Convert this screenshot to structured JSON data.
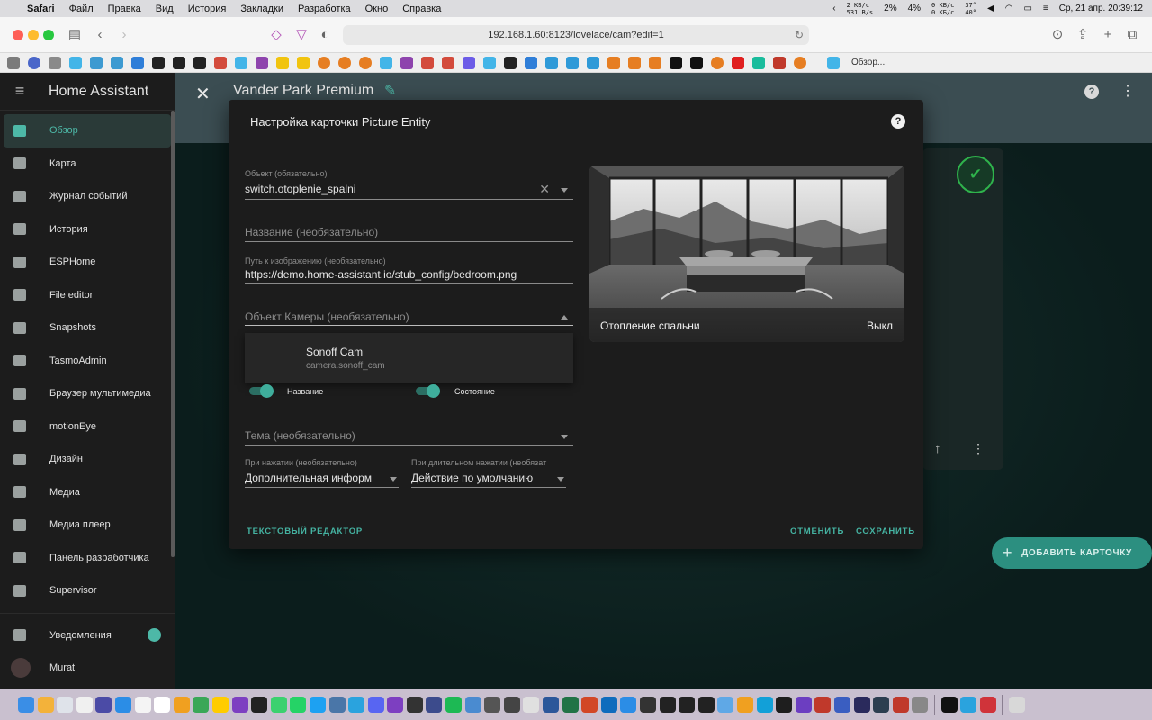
{
  "menubar": {
    "app": "Safari",
    "items": [
      "Файл",
      "Правка",
      "Вид",
      "История",
      "Закладки",
      "Разработка",
      "Окно",
      "Справка"
    ],
    "net1": "2 КБ/с",
    "net2": "531 B/s",
    "cpu1": "2%",
    "cpu2": "4%",
    "disk1": "0 КБ/с",
    "disk2": "0 КБ/с",
    "temp1": "37°",
    "temp2": "40°",
    "datetime": "Ср, 21 апр.  20:39:12"
  },
  "browser": {
    "url": "192.168.1.60:8123/lovelace/cam?edit=1",
    "tab_label": "Обзор..."
  },
  "sidebar": {
    "title": "Home Assistant",
    "items": [
      {
        "label": "Обзор"
      },
      {
        "label": "Карта"
      },
      {
        "label": "Журнал событий"
      },
      {
        "label": "История"
      },
      {
        "label": "ESPHome"
      },
      {
        "label": "File editor"
      },
      {
        "label": "Snapshots"
      },
      {
        "label": "TasmoAdmin"
      },
      {
        "label": "Браузер мультимедиа"
      },
      {
        "label": "motionEye"
      },
      {
        "label": "Дизайн"
      },
      {
        "label": "Медиа"
      },
      {
        "label": "Медиа плеер"
      },
      {
        "label": "Панель разработчика"
      },
      {
        "label": "Supervisor"
      }
    ],
    "notifications": "Уведомления",
    "user": "Murat"
  },
  "toolbar": {
    "title": "Vander Park Premium"
  },
  "dialog": {
    "title": "Настройка карточки Picture Entity",
    "entity": {
      "label": "Объект (обязательно)",
      "value": "switch.otoplenie_spalni"
    },
    "name": {
      "placeholder": "Название (необязательно)"
    },
    "image": {
      "label": "Путь к изображению (необязательно)",
      "value": "https://demo.home-assistant.io/stub_config/bedroom.png"
    },
    "camera": {
      "placeholder": "Объект Камеры (необязательно)"
    },
    "camera_option": {
      "title": "Sonoff Cam",
      "subtitle": "camera.sonoff_cam"
    },
    "toggle_name": "Название",
    "toggle_state": "Состояние",
    "theme": {
      "placeholder": "Тема (необязательно)"
    },
    "tap": {
      "label": "При нажатии (необязательно)",
      "value": "Дополнительная информ"
    },
    "hold": {
      "label": "При длительном нажатии (необязат",
      "value": "Действие по умолчанию"
    },
    "preview_name": "Отопление спальни",
    "preview_state": "Выкл",
    "code_editor": "ТЕКСТОВЫЙ РЕДАКТОР",
    "cancel": "ОТМЕНИТЬ",
    "save": "СОХРАНИТЬ"
  },
  "fab_label": "ДОБАВИТЬ КАРТОЧКУ",
  "colors": {
    "accent": "#4db8a7",
    "toolbar": "#3b4d52",
    "dialog": "#1c1c1c"
  }
}
